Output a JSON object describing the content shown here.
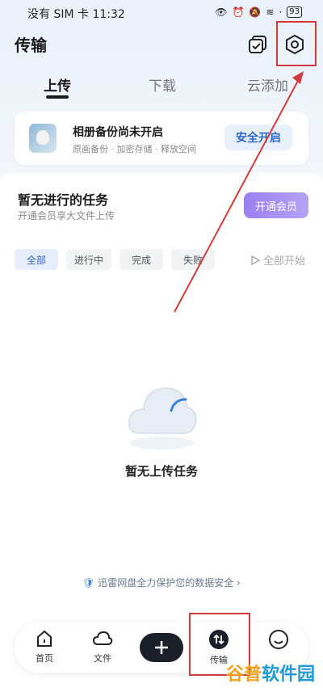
{
  "status_bar": {
    "carrier": "没有 SIM 卡 11:32",
    "battery": "93"
  },
  "header": {
    "title": "传输"
  },
  "tabs": [
    {
      "label": "上传"
    },
    {
      "label": "下载"
    },
    {
      "label": "云添加"
    }
  ],
  "backup_card": {
    "title": "相册备份尚未开启",
    "subtitle": "原画备份 · 加密存储 · 释放空间",
    "button": "安全开启"
  },
  "tasks": {
    "title": "暂无进行的任务",
    "subtitle": "开通会员享大文件上传",
    "vip_button": "开通会员"
  },
  "filters": [
    {
      "label": "全部"
    },
    {
      "label": "进行中"
    },
    {
      "label": "完成"
    },
    {
      "label": "失败"
    }
  ],
  "start_all": "全部开始",
  "empty": {
    "text": "暂无上传任务"
  },
  "security_note": "迅雷网盘全力保护您的数据安全",
  "nav": [
    {
      "label": "首页"
    },
    {
      "label": "文件"
    },
    {
      "label": "传输"
    }
  ],
  "watermark": {
    "part1": "谷普",
    "part2": "软件园"
  },
  "colors": {
    "accent": "#2d68c4",
    "annotation": "#d33a3a",
    "vip": "#9b7ff2"
  }
}
